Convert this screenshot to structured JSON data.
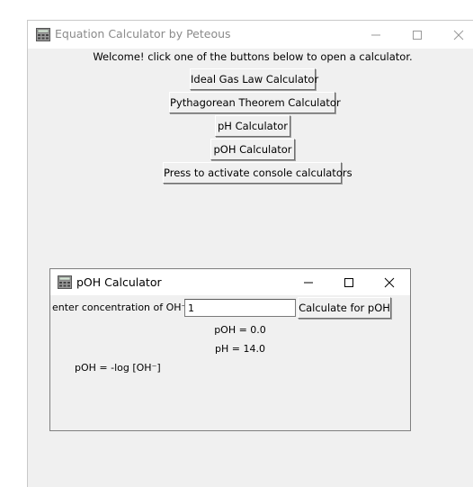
{
  "main_window": {
    "title": "Equation Calculator by Peteous",
    "welcome": "Welcome! click one of the buttons below to open a calculator.",
    "buttons": [
      "Ideal Gas Law Calculator",
      "Pythagorean Theorem Calculator",
      "pH Calculator",
      "pOH Calculator",
      "Press to activate console calculators"
    ]
  },
  "poh_window": {
    "title": "pOH Calculator",
    "label": "enter concentration of OH⁻",
    "input_value": "1",
    "calc_button": "Calculate for pOH",
    "poh_result": "pOH = 0.0",
    "ph_result": "pH = 14.0",
    "formula": "pOH = -log [OH⁻]"
  },
  "colors": {
    "window_bg": "#f0f0f0",
    "titlebar_bg": "#ffffff",
    "inactive_title": "#8a8a8a"
  }
}
